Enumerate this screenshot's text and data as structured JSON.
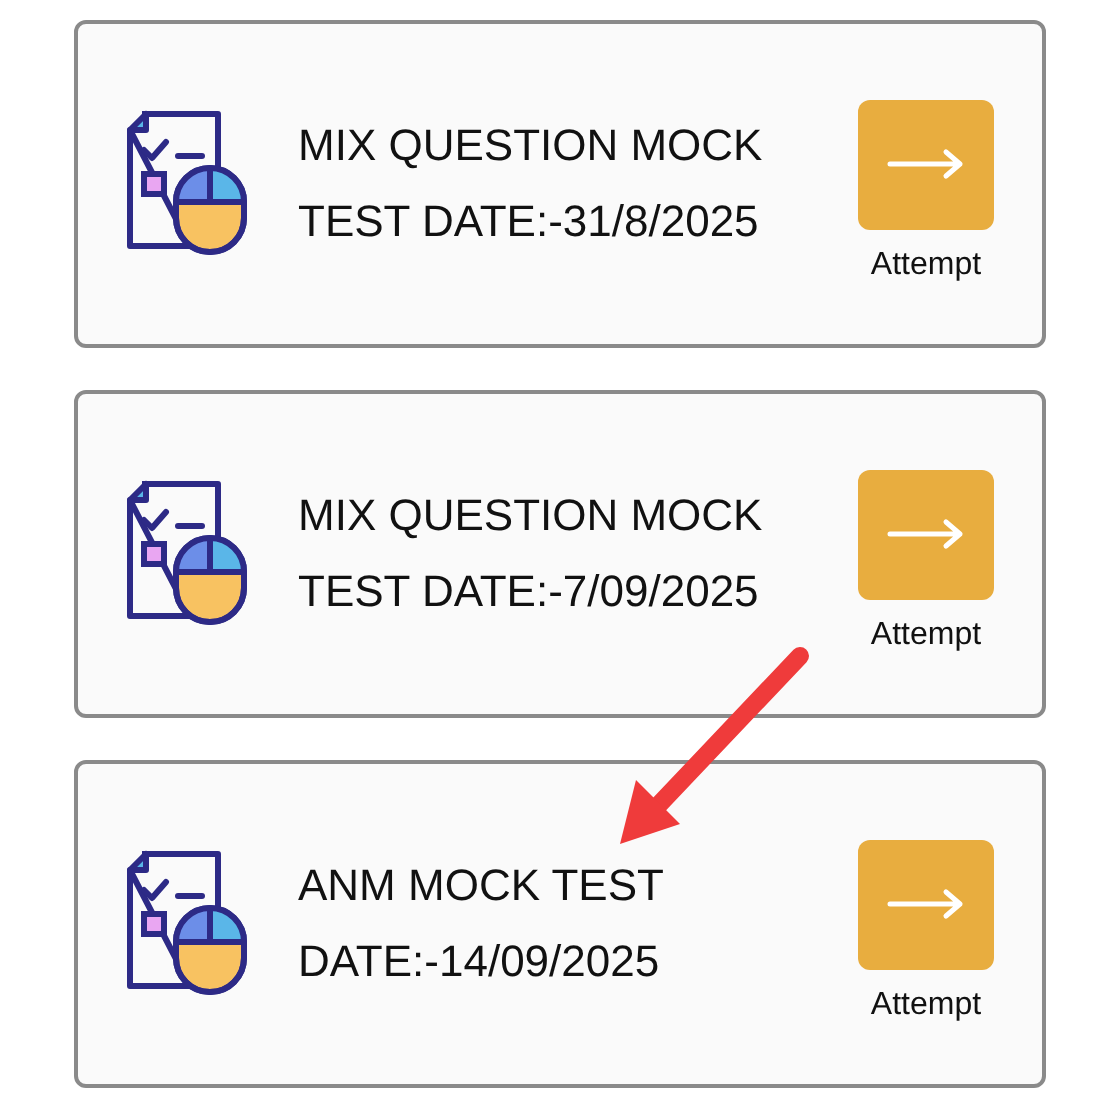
{
  "tests": [
    {
      "title_lines": [
        "MIX QUESTION MOCK",
        "TEST DATE:-31/8/2025"
      ],
      "button_label": "Attempt"
    },
    {
      "title_lines": [
        "MIX QUESTION MOCK",
        "TEST DATE:-7/09/2025"
      ],
      "button_label": "Attempt"
    },
    {
      "title_lines": [
        "ANM MOCK TEST",
        "DATE:-14/09/2025"
      ],
      "button_label": "Attempt"
    }
  ]
}
